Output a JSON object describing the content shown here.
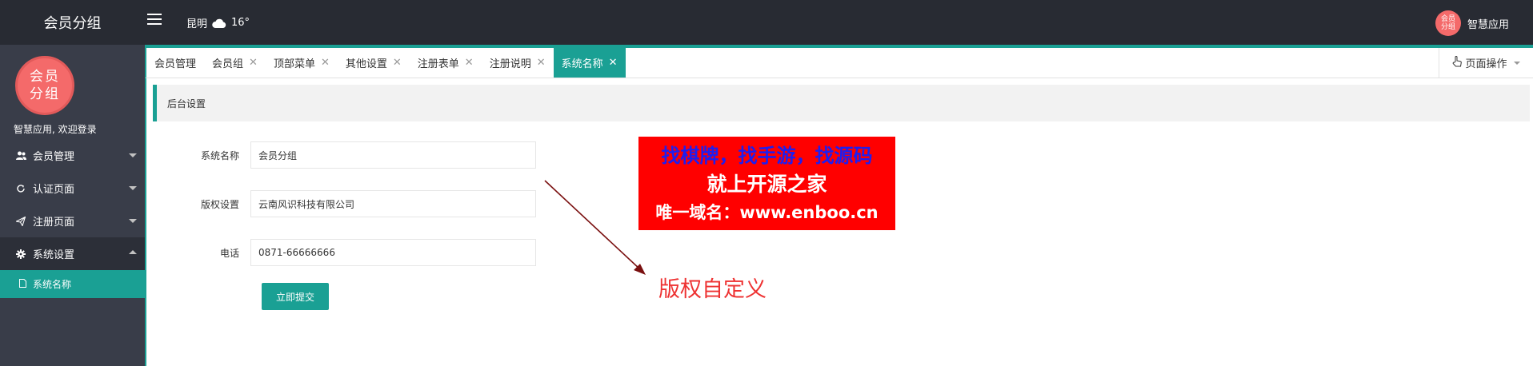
{
  "topbar": {
    "brand": "会员分组",
    "city": "昆明",
    "temperature": "16°",
    "weather_icon": "cloud-icon",
    "user_name": "智慧应用",
    "avatar_text": "会员分组"
  },
  "sidebar": {
    "avatar_text": "会员分组",
    "welcome": "智慧应用, 欢迎登录",
    "items": [
      {
        "label": "会员管理",
        "icon": "users-icon"
      },
      {
        "label": "认证页面",
        "icon": "refresh-icon"
      },
      {
        "label": "注册页面",
        "icon": "send-icon"
      },
      {
        "label": "系统设置",
        "icon": "gear-icon",
        "open": true
      }
    ],
    "sub_items": [
      {
        "label": "系统名称",
        "icon": "file-icon",
        "active": true
      }
    ]
  },
  "tabs": [
    {
      "label": "会员管理",
      "closable": false
    },
    {
      "label": "会员组",
      "closable": true
    },
    {
      "label": "顶部菜单",
      "closable": true
    },
    {
      "label": "其他设置",
      "closable": true
    },
    {
      "label": "注册表单",
      "closable": true
    },
    {
      "label": "注册说明",
      "closable": true
    },
    {
      "label": "系统名称",
      "closable": true,
      "active": true
    }
  ],
  "page_ops_label": "页面操作",
  "content": {
    "section_title": "后台设置",
    "fields": [
      {
        "label": "系统名称",
        "value": "会员分组"
      },
      {
        "label": "版权设置",
        "value": "云南风识科技有限公司"
      },
      {
        "label": "电话",
        "value": "0871-66666666"
      }
    ],
    "submit_label": "立即提交"
  },
  "ad": {
    "line1": "找棋牌，找手游，找源码",
    "line2": "就上开源之家",
    "line3": "唯一域名：www.enboo.cn"
  },
  "annotation": "版权自定义",
  "colors": {
    "accent": "#1aa094",
    "topbar": "#282b33",
    "sidebar": "#393d49",
    "avatar": "#f46a6a",
    "ad_bg": "#ff0000",
    "annotation": "#ee3333"
  }
}
